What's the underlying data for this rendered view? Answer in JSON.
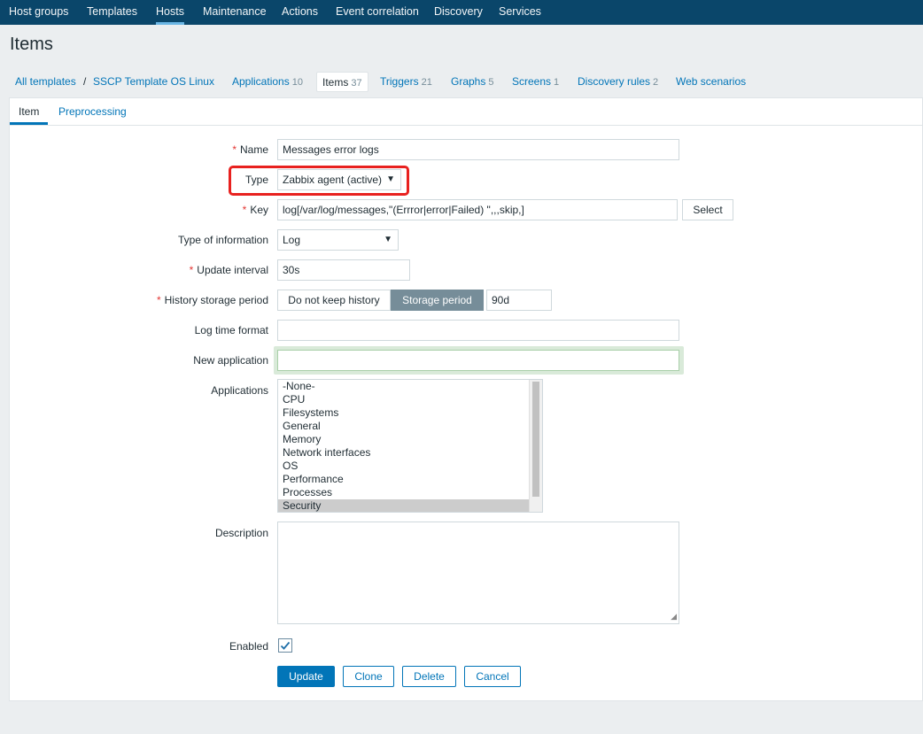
{
  "topnav": {
    "items": [
      "Host groups",
      "Templates",
      "Hosts",
      "Maintenance",
      "Actions",
      "Event correlation",
      "Discovery",
      "Services"
    ],
    "active": "Hosts"
  },
  "page": {
    "title": "Items"
  },
  "subnav": {
    "all_templates": "All templates",
    "separator": "/",
    "template": "SSCP Template OS Linux",
    "tabs": [
      {
        "label": "Applications",
        "count": "10"
      },
      {
        "label": "Items",
        "count": "37"
      },
      {
        "label": "Triggers",
        "count": "21"
      },
      {
        "label": "Graphs",
        "count": "5"
      },
      {
        "label": "Screens",
        "count": "1"
      },
      {
        "label": "Discovery rules",
        "count": "2"
      },
      {
        "label": "Web scenarios",
        "count": ""
      }
    ]
  },
  "form_tabs": {
    "item": "Item",
    "preprocessing": "Preprocessing"
  },
  "form": {
    "required_mark": "*",
    "name": {
      "label": "Name",
      "value": "Messages error logs"
    },
    "type": {
      "label": "Type",
      "value": "Zabbix agent (active)"
    },
    "key": {
      "label": "Key",
      "value": "log[/var/log/messages,\"(Errror|error|Failed) \",,,skip,]",
      "select_button": "Select"
    },
    "type_of_information": {
      "label": "Type of information",
      "value": "Log"
    },
    "update_interval": {
      "label": "Update interval",
      "value": "30s"
    },
    "history": {
      "label": "History storage period",
      "option_off": "Do not keep history",
      "option_on": "Storage period",
      "value": "90d"
    },
    "log_time_format": {
      "label": "Log time format",
      "value": ""
    },
    "new_application": {
      "label": "New application",
      "value": ""
    },
    "applications": {
      "label": "Applications",
      "options": [
        "-None-",
        "CPU",
        "Filesystems",
        "General",
        "Memory",
        "Network interfaces",
        "OS",
        "Performance",
        "Processes",
        "Security"
      ],
      "selected": "Security"
    },
    "description": {
      "label": "Description",
      "value": ""
    },
    "enabled": {
      "label": "Enabled",
      "checked": true
    }
  },
  "buttons": {
    "update": "Update",
    "clone": "Clone",
    "delete": "Delete",
    "cancel": "Cancel"
  },
  "colors": {
    "nav_bg": "#0a466a",
    "link": "#0275b8",
    "highlight": "#e8211f",
    "required": "#e33734"
  }
}
